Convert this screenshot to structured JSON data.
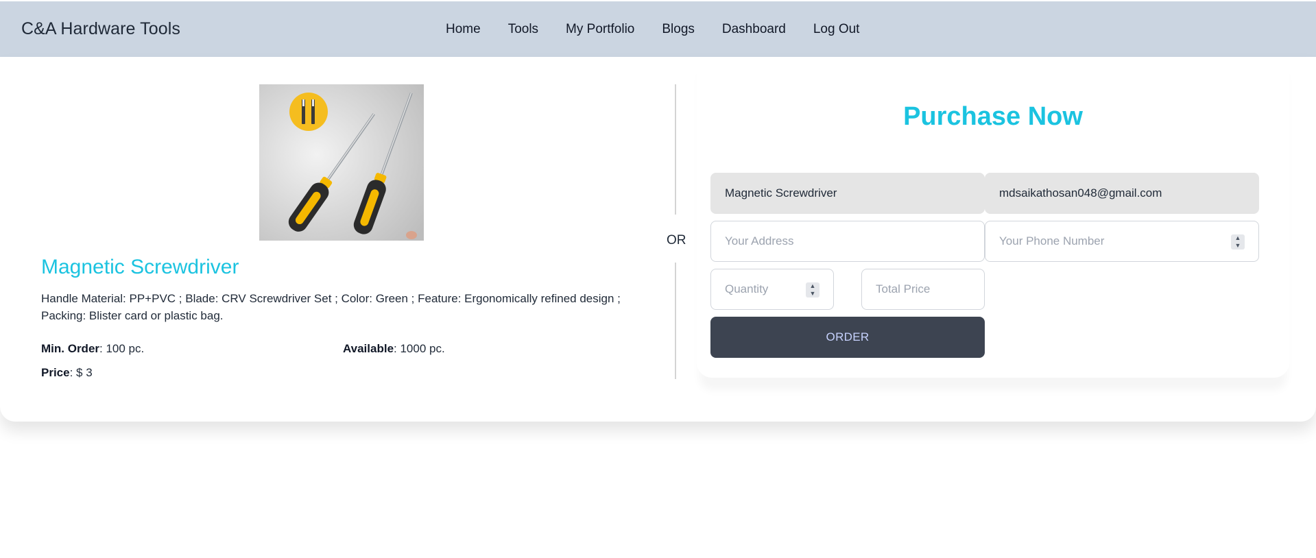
{
  "brand": "C&A Hardware Tools",
  "nav": [
    "Home",
    "Tools",
    "My Portfolio",
    "Blogs",
    "Dashboard",
    "Log Out"
  ],
  "product": {
    "name": "Magnetic Screwdriver",
    "description": "Handle Material: PP+PVC ; Blade: CRV Screwdriver Set ; Color: Green ; Feature: Ergonomically refined design ; Packing: Blister card or plastic bag.",
    "min_order_label": "Min. Order",
    "min_order_value": ": 100 pc.",
    "available_label": "Available",
    "available_value": ": 1000 pc.",
    "price_label": "Price",
    "price_value": ": $ 3"
  },
  "divider_text": "OR",
  "form": {
    "title": "Purchase Now",
    "product_name_value": "Magnetic Screwdriver",
    "email_value": "mdsaikathosan048@gmail.com",
    "address_placeholder": "Your Address",
    "phone_placeholder": "Your Phone Number",
    "quantity_placeholder": "Quantity",
    "total_price_placeholder": "Total Price",
    "order_label": "ORDER"
  },
  "colors": {
    "navbar_bg": "#cbd5e1",
    "accent": "#1bc3e0",
    "button_bg": "#3d4451",
    "button_text": "#c7d2fe"
  }
}
